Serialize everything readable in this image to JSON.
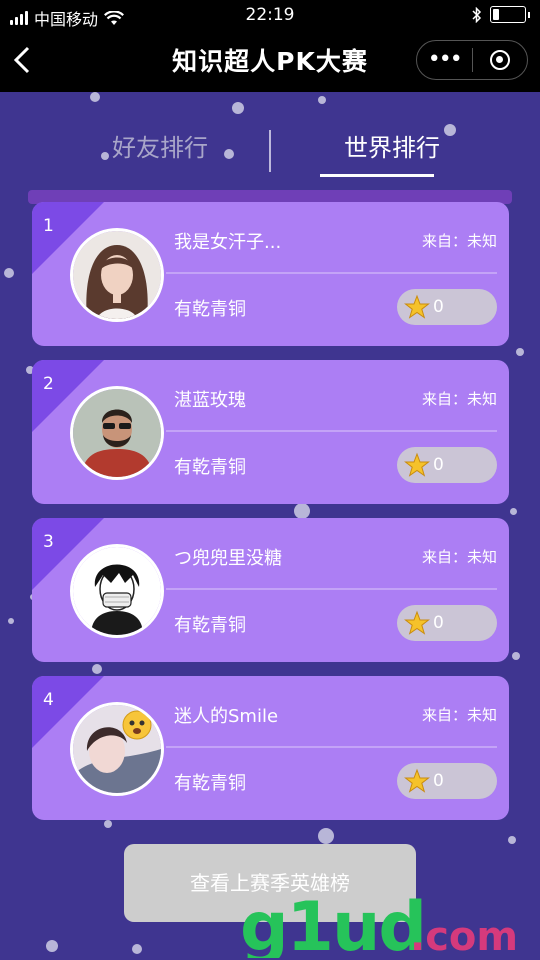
{
  "status_bar": {
    "carrier": "中国移动",
    "time": "22:19"
  },
  "nav": {
    "title": "知识超人PK大赛"
  },
  "tabs": [
    {
      "label": "好友排行",
      "active": false
    },
    {
      "label": "世界排行",
      "active": true
    }
  ],
  "rankings": [
    {
      "rank": "1",
      "name": "我是女汗子...",
      "origin": "来自：未知",
      "tier": "有乾青铜",
      "score": "0",
      "avatar": "woman-long-hair"
    },
    {
      "rank": "2",
      "name": "湛蓝玫瑰",
      "origin": "来自：未知",
      "tier": "有乾青铜",
      "score": "0",
      "avatar": "man-beard-sunglasses"
    },
    {
      "rank": "3",
      "name": "つ兜兜里没糖",
      "origin": "来自：未知",
      "tier": "有乾青铜",
      "score": "0",
      "avatar": "masked-boy-sketch"
    },
    {
      "rank": "4",
      "name": "迷人的Smile",
      "origin": "来自：未知",
      "tier": "有乾青铜",
      "score": "0",
      "avatar": "girl-emoji"
    }
  ],
  "footer": {
    "history_button": "查看上赛季英雄榜"
  },
  "watermark": {
    "text": "g1ud.com"
  },
  "colors": {
    "background": "#3f3590",
    "card": "#ac7ef4",
    "corner": "#7c4ae6",
    "accent_green": "#26c35a"
  }
}
